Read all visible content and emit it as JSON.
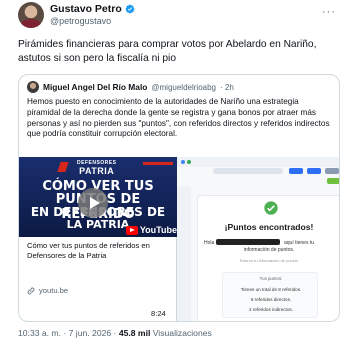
{
  "tweet": {
    "author_name": "Gustavo Petro",
    "author_handle": "@petrogustavo",
    "more_label": "···",
    "text": "Pirámides financieras para comprar votos por Abelardo en Nariño, astutos si son pero la fiscalía ni pio",
    "timestamp": "10:33 a. m. · 7 jun. 2026 ·",
    "views_count": "45.8 mil",
    "views_label": "Visualizaciones"
  },
  "quote": {
    "author_name": "Miguel Angel Del Río Malo",
    "author_handle": "@migueldelrioabg",
    "time_ago": "· 2h",
    "text": "Hemos puesto en conocimiento de la autoridades de Nariño una estrategia piramidal de la derecha donde la gente se registra y gana bonos por atraer más personas y así no pierden sus \"puntos\", con referidos directos y referidos indirectos que podría constituir corrupción electoral."
  },
  "youtube_card": {
    "thumb_brand_small": "DEFENSORES",
    "thumb_brand_large": "PATRIA",
    "thumb_line1": "CÓMO VER TUS",
    "thumb_line2": "PUNTOS DE REFERIDO",
    "thumb_line3": "EN DEFENSORES DE",
    "thumb_line4": "LA PATRIA",
    "youtube_logo_text": "YouTube",
    "title": "Cómo ver tus puntos de referidos en Defensores de la Patria",
    "domain": "youtu.be",
    "duration": "8:24"
  },
  "screenshot": {
    "found_title": "¡Puntos encontrados!",
    "greeting": "Hola",
    "greeting_suffix": "aquí tienes tu",
    "info_line": "información de puntos.",
    "sub_note": "Esta es tu información de puntos",
    "box_heading": "Tus puntos:",
    "total_line": "Tienes un total de 8 referidos.",
    "direct_line": "6 referidos directos.",
    "indirect_line": "2 referidos indirectos."
  },
  "colors": {
    "verified": "#1d9bf0",
    "text_primary": "#0f1419",
    "text_secondary": "#536471",
    "youtube_red": "#ff0000"
  },
  "icons": {
    "verified": "verified-badge-icon",
    "more": "more-options-icon",
    "link": "link-icon",
    "play": "play-icon"
  }
}
